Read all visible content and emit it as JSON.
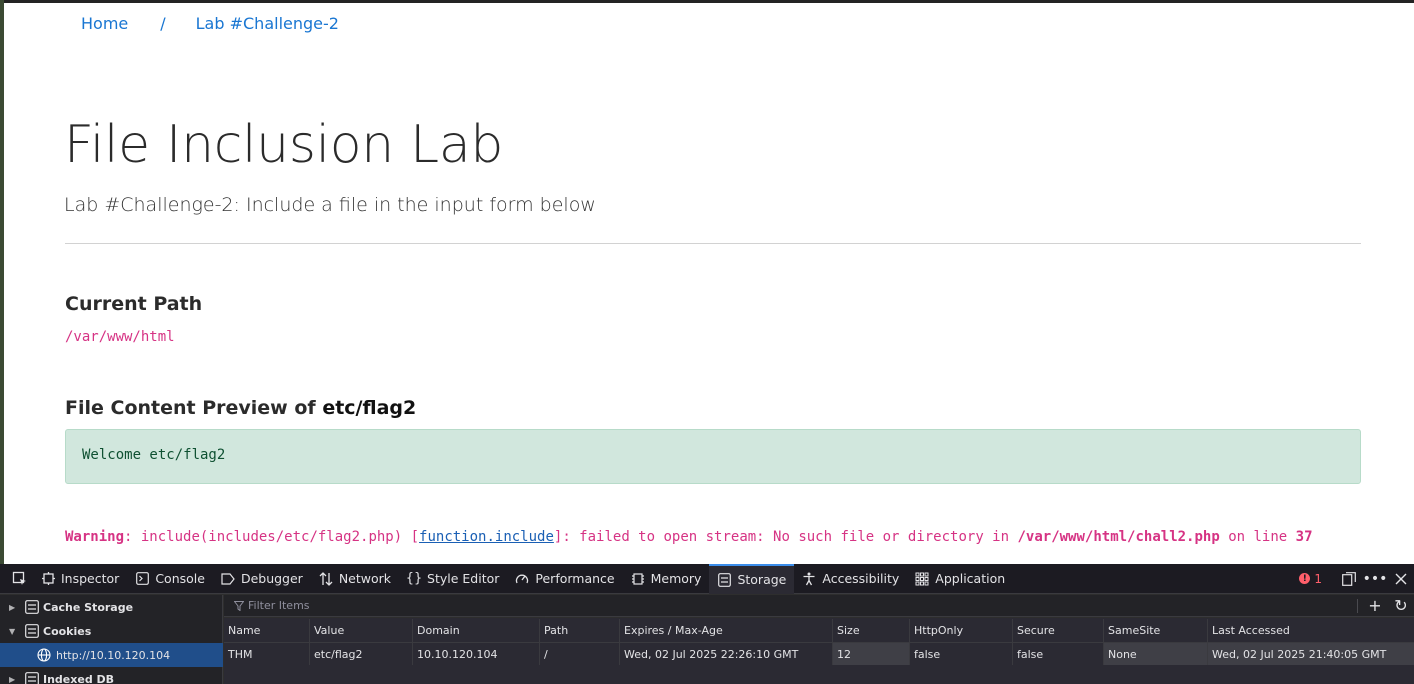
{
  "page": {
    "breadcrumb": {
      "home": "Home",
      "separator": "/",
      "current": "Lab #Challenge-2"
    },
    "title": "File Inclusion Lab",
    "subtitle": "Lab #Challenge-2: Include a file in the input form below",
    "path_heading": "Current Path",
    "path_value": "/var/www/html",
    "preview_heading_prefix": "File Content Preview of",
    "preview_file": "etc/flag2",
    "preview_content": "Welcome etc/flag2",
    "warning": {
      "label": "Warning",
      "text1": ": include(includes/etc/flag2.php) [",
      "link": "function.include",
      "text2": "]: failed to open stream: No such file or directory in ",
      "file": "/var/www/html/chall2.php",
      "text3": " on line ",
      "line": "37"
    }
  },
  "devtools": {
    "tabs": [
      {
        "label": "Inspector",
        "icon": "inspector-icon"
      },
      {
        "label": "Console",
        "icon": "console-icon"
      },
      {
        "label": "Debugger",
        "icon": "debugger-icon"
      },
      {
        "label": "Network",
        "icon": "network-icon"
      },
      {
        "label": "Style Editor",
        "icon": "style-editor-icon"
      },
      {
        "label": "Performance",
        "icon": "performance-icon"
      },
      {
        "label": "Memory",
        "icon": "memory-icon"
      },
      {
        "label": "Storage",
        "icon": "storage-icon",
        "active": true
      },
      {
        "label": "Accessibility",
        "icon": "accessibility-icon"
      },
      {
        "label": "Application",
        "icon": "application-icon"
      }
    ],
    "error_count": "1",
    "sidebar": {
      "cache_storage": "Cache Storage",
      "cookies": "Cookies",
      "cookie_host": "http://10.10.120.104",
      "indexed_db": "Indexed DB"
    },
    "filter_placeholder": "Filter Items",
    "table": {
      "columns": [
        "Name",
        "Value",
        "Domain",
        "Path",
        "Expires / Max-Age",
        "Size",
        "HttpOnly",
        "Secure",
        "SameSite",
        "Last Accessed"
      ],
      "rows": [
        [
          "THM",
          "etc/flag2",
          "10.10.120.104",
          "/",
          "Wed, 02 Jul 2025 22:26:10 GMT",
          "12",
          "false",
          "false",
          "None",
          "Wed, 02 Jul 2025 21:40:05 GMT"
        ]
      ]
    },
    "colors": {
      "accent": "#3b8dea",
      "selected": "#204e8a",
      "error": "#ff5f6b"
    }
  }
}
